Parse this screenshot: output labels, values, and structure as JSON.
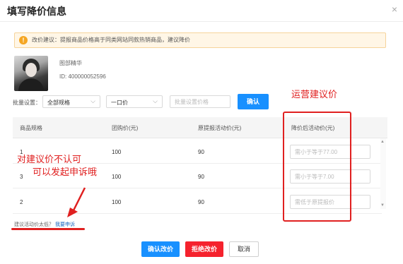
{
  "dialog": {
    "title": "填写降价信息",
    "close_symbol": "×"
  },
  "notice": {
    "icon": "exclamation-icon",
    "text": "改价建议：提报商品价格高于同类网站同款热销商品，建议降价"
  },
  "product": {
    "name": "图部精华",
    "id_text": "ID: 400000052596"
  },
  "batch": {
    "label": "批量设置：",
    "spec_select": "全部规格",
    "price_type_select": "一口价",
    "price_placeholder": "批量设置价格",
    "confirm_label": "确认"
  },
  "table": {
    "headers": [
      "商品规格",
      "团购价(元)",
      "原提报活动价(元)",
      "降价后活动价(元)"
    ],
    "rows": [
      {
        "spec": "1",
        "group_price": "100",
        "original_price": "90",
        "placeholder": "需小于等于77.00"
      },
      {
        "spec": "3",
        "group_price": "100",
        "original_price": "90",
        "placeholder": "需小于等于7.00"
      },
      {
        "spec": "2",
        "group_price": "100",
        "original_price": "90",
        "placeholder": "需低于原提报价"
      }
    ]
  },
  "annotations": {
    "right": "运营建议价",
    "left_line1": "对建议价不认可",
    "left_line2": "可以发起申诉哦",
    "color": "#e02020"
  },
  "appeal": {
    "question": "建议活动价太低？",
    "link": "我要申诉"
  },
  "footer": {
    "confirm": "确认改价",
    "reject": "拒绝改价",
    "cancel": "取消"
  },
  "colors": {
    "primary": "#1890ff",
    "danger": "#f5222d",
    "notice_bg": "#fff6e6"
  }
}
